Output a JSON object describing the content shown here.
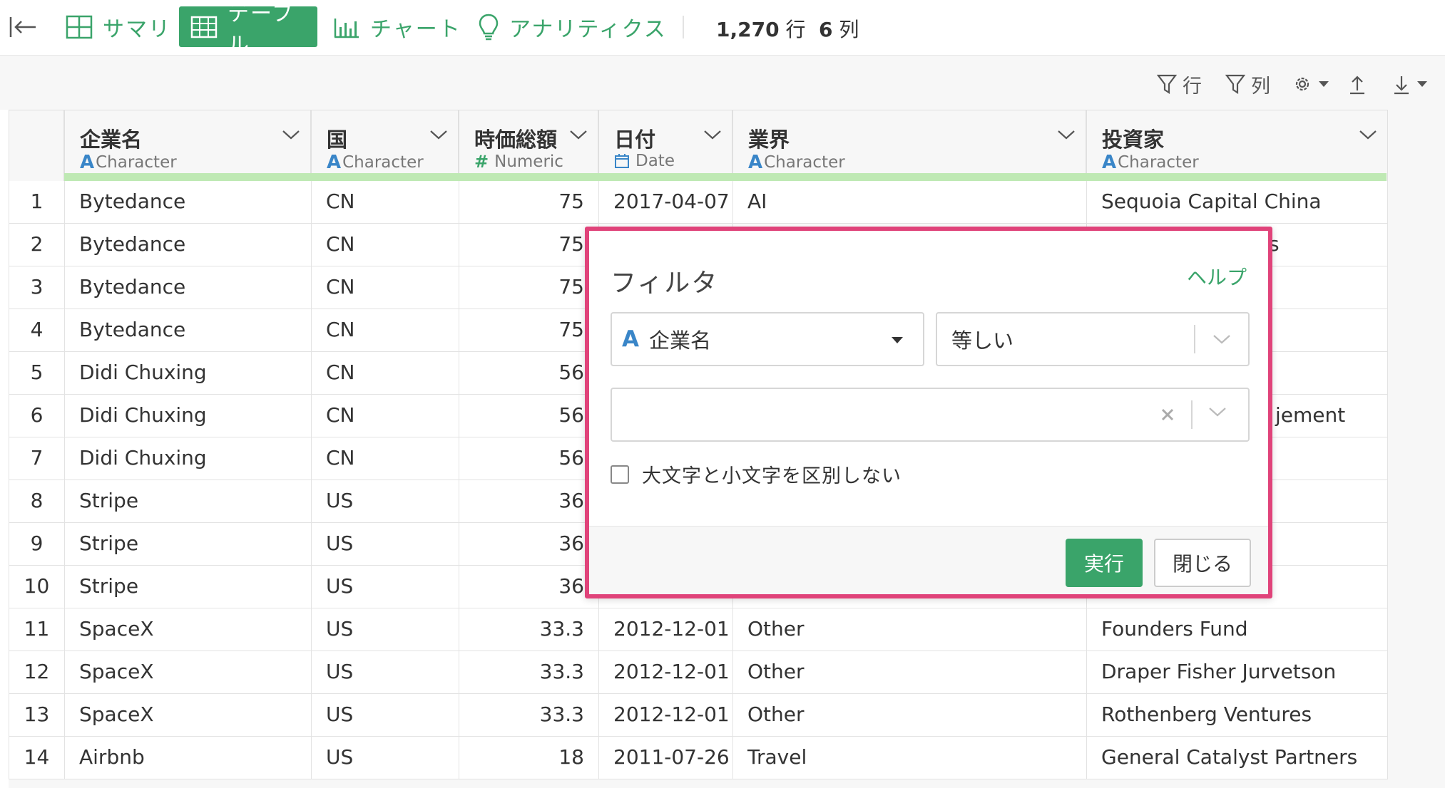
{
  "toolbar": {
    "back_icon": "collapse-left-icon",
    "tabs": [
      {
        "label": "サマリ",
        "icon": "summary-grid-icon"
      },
      {
        "label": "テーブル",
        "icon": "table-icon"
      },
      {
        "label": "チャート",
        "icon": "bar-chart-icon"
      },
      {
        "label": "アナリティクス",
        "icon": "lightbulb-icon"
      }
    ],
    "active_tab": "テーブル",
    "row_count": "1,270",
    "row_unit": "行",
    "col_count": "6",
    "col_unit": "列"
  },
  "subtoolbar": {
    "row_filter_label": "行",
    "col_filter_label": "列"
  },
  "columns": [
    {
      "name": "企業名",
      "type": "Character",
      "type_symbol": "A"
    },
    {
      "name": "国",
      "type": "Character",
      "type_symbol": "A"
    },
    {
      "name": "時価総額",
      "type": "Numeric",
      "type_symbol": "#"
    },
    {
      "name": "日付",
      "type": "Date",
      "type_symbol": "calendar-icon"
    },
    {
      "name": "業界",
      "type": "Character",
      "type_symbol": "A"
    },
    {
      "name": "投資家",
      "type": "Character",
      "type_symbol": "A"
    }
  ],
  "rows": [
    {
      "idx": "1",
      "company": "Bytedance",
      "country": "CN",
      "value": "75",
      "date": "2017-04-07",
      "industry": "AI",
      "investor": "Sequoia Capital China"
    },
    {
      "idx": "2",
      "company": "Bytedance",
      "country": "CN",
      "value": "75",
      "date": "",
      "industry": "",
      "investor": "ts"
    },
    {
      "idx": "3",
      "company": "Bytedance",
      "country": "CN",
      "value": "75",
      "date": "",
      "industry": "",
      "investor": ""
    },
    {
      "idx": "4",
      "company": "Bytedance",
      "country": "CN",
      "value": "75",
      "date": "",
      "industry": "",
      "investor": ""
    },
    {
      "idx": "5",
      "company": "Didi Chuxing",
      "country": "CN",
      "value": "56",
      "date": "",
      "industry": "",
      "investor": ""
    },
    {
      "idx": "6",
      "company": "Didi Chuxing",
      "country": "CN",
      "value": "56",
      "date": "",
      "industry": "",
      "investor": "jement"
    },
    {
      "idx": "7",
      "company": "Didi Chuxing",
      "country": "CN",
      "value": "56",
      "date": "",
      "industry": "",
      "investor": ""
    },
    {
      "idx": "8",
      "company": "Stripe",
      "country": "US",
      "value": "36",
      "date": "",
      "industry": "",
      "investor": ""
    },
    {
      "idx": "9",
      "company": "Stripe",
      "country": "US",
      "value": "36",
      "date": "",
      "industry": "",
      "investor": ""
    },
    {
      "idx": "10",
      "company": "Stripe",
      "country": "US",
      "value": "36",
      "date": "",
      "industry": "",
      "investor": ""
    },
    {
      "idx": "11",
      "company": "SpaceX",
      "country": "US",
      "value": "33.3",
      "date": "2012-12-01",
      "industry": "Other",
      "investor": "Founders Fund"
    },
    {
      "idx": "12",
      "company": "SpaceX",
      "country": "US",
      "value": "33.3",
      "date": "2012-12-01",
      "industry": "Other",
      "investor": "Draper Fisher Jurvetson"
    },
    {
      "idx": "13",
      "company": "SpaceX",
      "country": "US",
      "value": "33.3",
      "date": "2012-12-01",
      "industry": "Other",
      "investor": "Rothenberg Ventures"
    },
    {
      "idx": "14",
      "company": "Airbnb",
      "country": "US",
      "value": "18",
      "date": "2011-07-26",
      "industry": "Travel",
      "investor": "General Catalyst Partners"
    }
  ],
  "filter_dialog": {
    "title": "フィルタ",
    "help_label": "ヘルプ",
    "column_select": {
      "type_symbol": "A",
      "value": "企業名"
    },
    "operator_select": {
      "value": "等しい"
    },
    "value_input": {
      "value": "",
      "placeholder": ""
    },
    "case_insensitive_label": "大文字と小文字を区別しない",
    "case_insensitive_checked": false,
    "run_label": "実行",
    "close_label": "閉じる",
    "accent_color": "#3aa46a",
    "border_color": "#e0437a"
  }
}
